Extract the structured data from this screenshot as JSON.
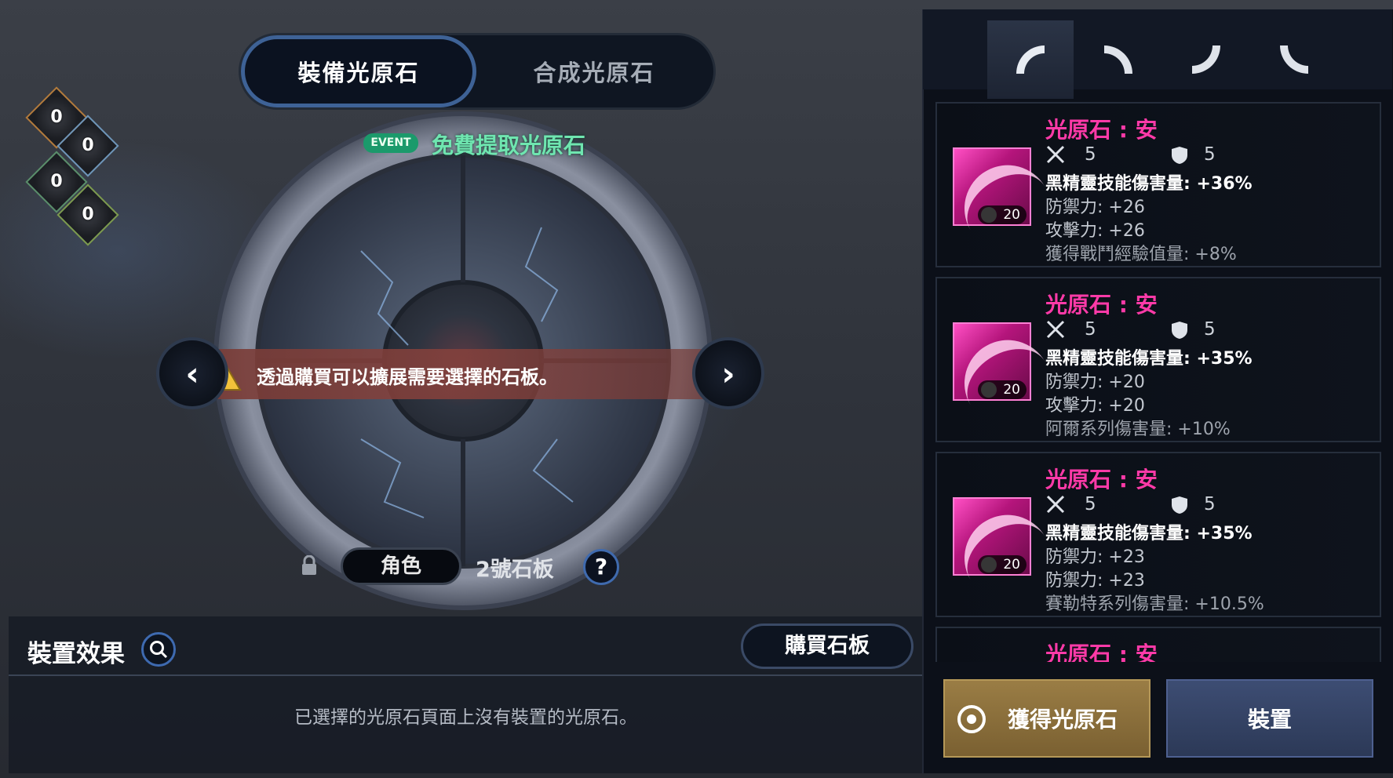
{
  "tabs": {
    "equip": "裝備光原石",
    "synth": "合成光原石"
  },
  "elements": [
    "0",
    "0",
    "0",
    "0"
  ],
  "event": {
    "badge": "EVENT",
    "text": "免費提取光原石"
  },
  "banner": {
    "text": "透過購買可以擴展需要選擇的石板。"
  },
  "nav": {
    "prev": "‹",
    "next": "›"
  },
  "slab": {
    "role": "角色",
    "label": "2號石板",
    "help": "?"
  },
  "effect": {
    "title": "裝置效果",
    "buy": "購買石板",
    "empty": "已選擇的光原石頁面上沒有裝置的光原石。"
  },
  "part_tabs": [
    "arc-top-left-icon",
    "arc-top-right-icon",
    "arc-bottom-left-icon",
    "arc-bottom-right-icon"
  ],
  "cards": [
    {
      "name": "光原石 : 安",
      "atk": "5",
      "def": "5",
      "level": "20",
      "lines": [
        "黑精靈技能傷害量: +36%",
        "防禦力: +26",
        "攻擊力: +26",
        "獲得戰鬥經驗值量: +8%"
      ]
    },
    {
      "name": "光原石 : 安",
      "atk": "5",
      "def": "5",
      "level": "20",
      "lines": [
        "黑精靈技能傷害量: +35%",
        "防禦力: +20",
        "攻擊力: +20",
        "阿爾系列傷害量: +10%"
      ]
    },
    {
      "name": "光原石 : 安",
      "atk": "5",
      "def": "5",
      "level": "20",
      "lines": [
        "黑精靈技能傷害量: +35%",
        "防禦力: +23",
        "防禦力: +23",
        "賽勒特系列傷害量: +10.5%"
      ]
    },
    {
      "name": "光原石 : 安"
    }
  ],
  "buttons": {
    "obtain": "獲得光原石",
    "equip": "裝置"
  },
  "colors": {
    "accent_blue": "#3e6296",
    "event_green": "#6fe6b0",
    "item_pink": "#ff3aa8",
    "gold_button": "#9a7d45"
  }
}
